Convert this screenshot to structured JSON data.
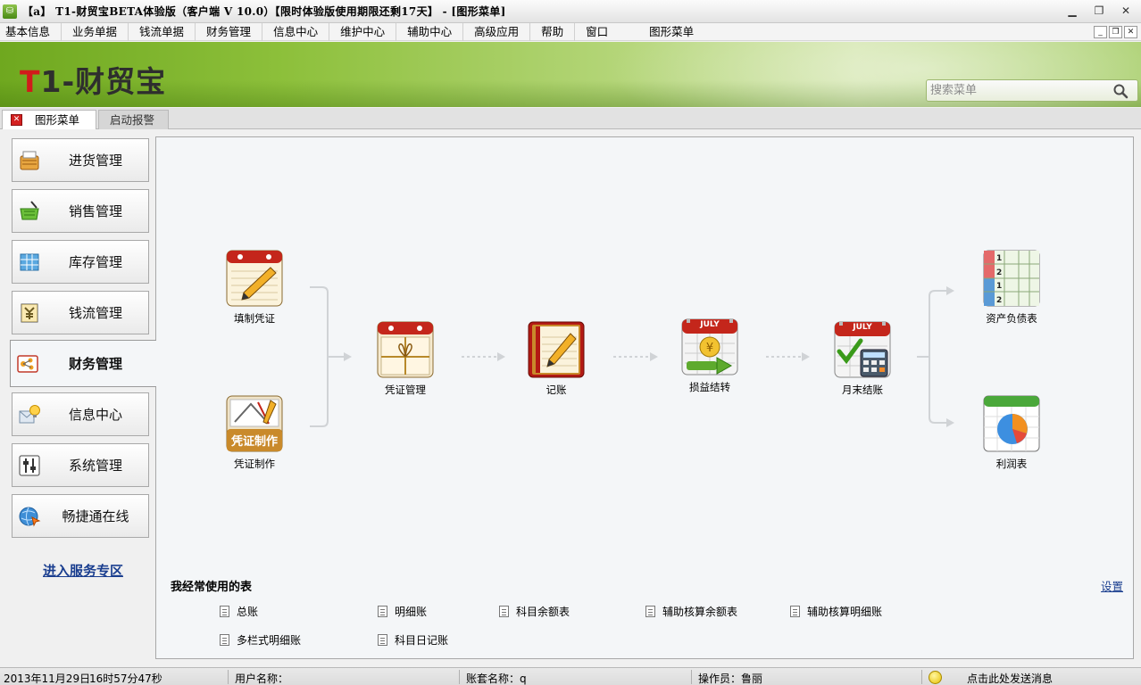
{
  "window": {
    "title": "【a】 T1-财贸宝BETA体验版（客户端 V 10.0）【限时体验版使用期限还剩17天】 - [图形菜单]",
    "icon_label": "a",
    "controls": [
      "minimize",
      "restore",
      "close"
    ]
  },
  "menubar": {
    "items": [
      "基本信息",
      "业务单据",
      "钱流单据",
      "财务管理",
      "信息中心",
      "维护中心",
      "辅助中心",
      "高级应用",
      "帮助",
      "窗口"
    ],
    "active_window": "图形菜单"
  },
  "banner": {
    "logo_t": "T",
    "logo_rest": "1-财贸宝",
    "search_placeholder": "搜索菜单"
  },
  "tabs": [
    {
      "label": "图形菜单",
      "active": true
    },
    {
      "label": "启动报警",
      "active": false
    }
  ],
  "sidebar": {
    "items": [
      {
        "label": "进货管理",
        "icon": "purchase-basket-icon"
      },
      {
        "label": "销售管理",
        "icon": "shopping-cart-icon"
      },
      {
        "label": "库存管理",
        "icon": "inventory-grid-icon"
      },
      {
        "label": "钱流管理",
        "icon": "money-flow-icon"
      },
      {
        "label": "财务管理",
        "icon": "finance-chart-icon",
        "active": true
      },
      {
        "label": "信息中心",
        "icon": "info-bulb-icon"
      },
      {
        "label": "系统管理",
        "icon": "settings-sliders-icon"
      },
      {
        "label": "畅捷通在线",
        "icon": "online-globe-icon"
      }
    ],
    "service_link": "进入服务专区"
  },
  "flow": {
    "nodes": [
      {
        "id": "fill-voucher",
        "label": "填制凭证",
        "icon": "notebook-pencil-icon"
      },
      {
        "id": "make-voucher",
        "label": "凭证制作",
        "icon": "voucher-drawing-icon",
        "icon_text": "凭证制作"
      },
      {
        "id": "voucher-mgmt",
        "label": "凭证管理",
        "icon": "voucher-bundle-icon"
      },
      {
        "id": "bookkeeping",
        "label": "记账",
        "icon": "ledger-pencil-icon"
      },
      {
        "id": "profit-transfer",
        "label": "损益结转",
        "icon": "calendar-coin-icon",
        "icon_text": "JULY"
      },
      {
        "id": "month-close",
        "label": "月末结账",
        "icon": "calendar-calculator-icon",
        "icon_text": "JULY"
      },
      {
        "id": "balance-sheet",
        "label": "资产负债表",
        "icon": "spreadsheet-icon"
      },
      {
        "id": "income-statement",
        "label": "利润表",
        "icon": "pie-chart-icon"
      }
    ]
  },
  "favorites": {
    "title": "我经常使用的表",
    "settings_label": "设置",
    "items": [
      "总账",
      "明细账",
      "科目余额表",
      "辅助核算余额表",
      "辅助核算明细账",
      "多栏式明细账",
      "科目日记账"
    ]
  },
  "statusbar": {
    "date": "2013年11月29日",
    "time": "16时57分47秒",
    "user_label": "用户名称：",
    "account_label": "账套名称：q",
    "operator_label": "操作员：鲁丽",
    "message_label": "点击此处发送消息"
  },
  "colors": {
    "brand_green": "#8dc03b",
    "logo_red": "#d11b1b",
    "link_blue": "#1a3e8f"
  }
}
